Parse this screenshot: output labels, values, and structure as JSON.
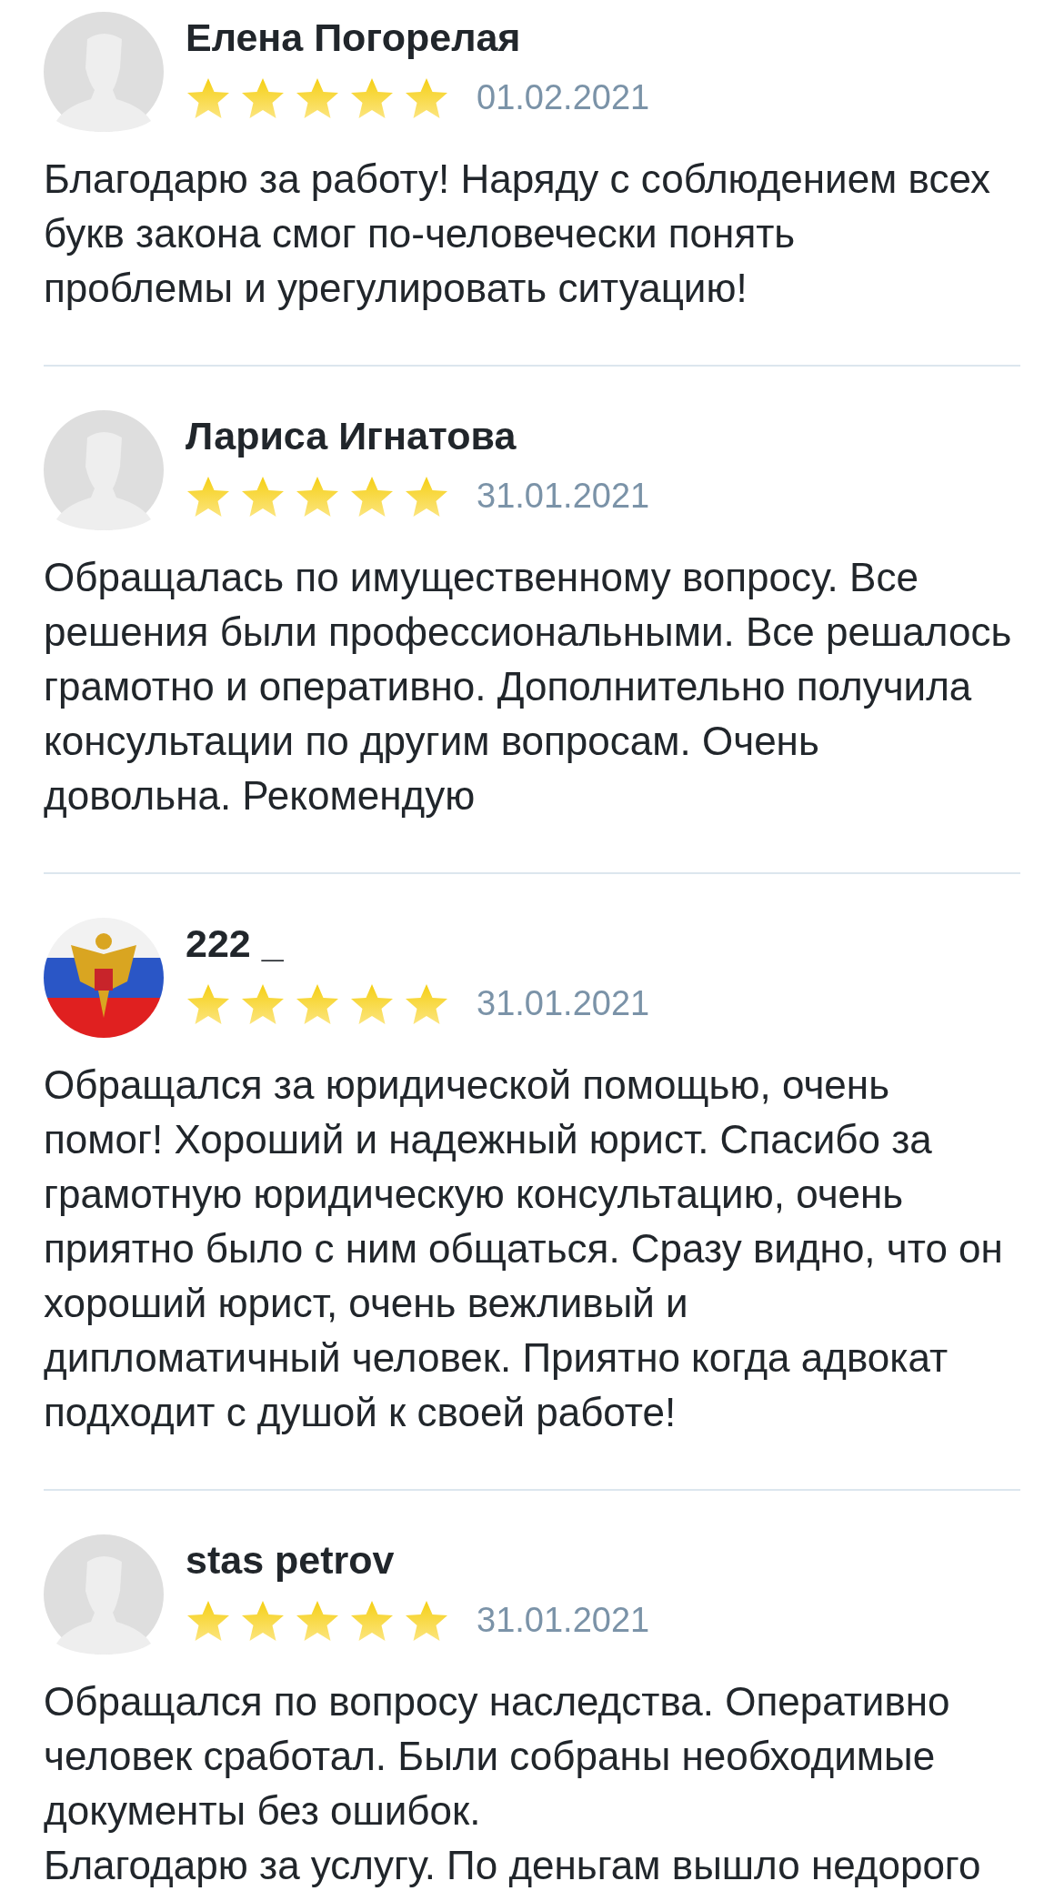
{
  "reviews": [
    {
      "author": "Елена Погорелая",
      "avatar": {
        "kind": "silhouette"
      },
      "stars": 5,
      "date": "01.02.2021",
      "text": "Благодарю за работу! Наряду с соблюдением всех\nбукв закона смог по-человечески понять\nпроблемы и урегулировать ситуацию!"
    },
    {
      "author": "Лариса Игнатова",
      "avatar": {
        "kind": "silhouette"
      },
      "stars": 5,
      "date": "31.01.2021",
      "text": "Обращалась по имущественному вопросу. Все\nрешения были профессиональными. Все решалось\nграмотно и оперативно. Дополнительно получила\nконсультации по другим вопросам. Очень\nдовольна. Рекомендую"
    },
    {
      "author": "222 _",
      "stars": 5,
      "date": "31.01.2021",
      "text": "Обращался за юридической помощью, очень\nпомог! Хороший и надежный юрист. Спасибо за\nграмотную юридическую консультацию, очень\nприятно было с ним общаться. Сразу видно, что он\nхороший юрист, очень вежливый и\nдипломатичный человек. Приятно когда адвокат\nподходит с душой к своей работе!"
    },
    {
      "author": "stas petrov",
      "avatar": {
        "kind": "silhouette"
      },
      "stars": 5,
      "date": "31.01.2021",
      "text": "Обращался по вопросу наследства. Оперативно\nчеловек сработал. Были собраны необходимые\nдокументы без ошибок.\nБлагодарю за услугу. По деньгам вышло недорого"
    }
  ]
}
